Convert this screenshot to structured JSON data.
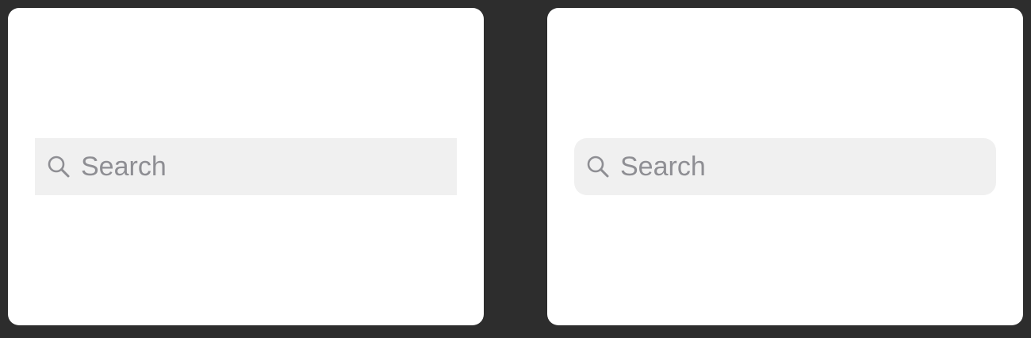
{
  "panels": [
    {
      "variant": "square",
      "search": {
        "placeholder": "Search",
        "value": "",
        "icon": "magnifying-glass"
      }
    },
    {
      "variant": "rounded",
      "search": {
        "placeholder": "Search",
        "value": "",
        "icon": "magnifying-glass"
      }
    }
  ],
  "colors": {
    "background": "#2d2d2d",
    "card": "#ffffff",
    "search_field": "#f0f0f0",
    "placeholder": "#8e8e93",
    "icon": "#8e8e93"
  }
}
